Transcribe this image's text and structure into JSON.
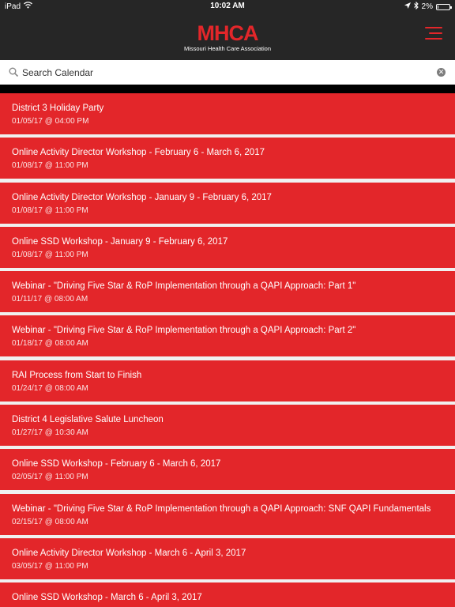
{
  "status_bar": {
    "device": "iPad",
    "time": "10:02 AM",
    "battery": "2%",
    "battery_level": 0.02
  },
  "header": {
    "logo_text": "MHCA",
    "logo_subtitle": "Missouri Health Care Association",
    "accent_color": "#e3262a",
    "background_color": "#262626",
    "menu_icon": "hamburger-menu-icon"
  },
  "search": {
    "placeholder": "Search Calendar",
    "icon": "search-icon",
    "clear_icon": "clear-icon"
  },
  "events": [
    {
      "title": "District 3 Holiday Party",
      "date": "01/05/17 @ 04:00 PM"
    },
    {
      "title": "Online Activity Director Workshop - February 6 - March 6, 2017",
      "date": "01/08/17 @ 11:00 PM"
    },
    {
      "title": "Online Activity Director Workshop - January 9 - February 6, 2017",
      "date": "01/08/17 @ 11:00 PM"
    },
    {
      "title": "Online SSD Workshop - January 9 - February 6, 2017",
      "date": "01/08/17 @ 11:00 PM"
    },
    {
      "title": "Webinar - \"Driving Five Star & RoP Implementation through a QAPI Approach: Part 1\"",
      "date": "01/11/17 @ 08:00 AM"
    },
    {
      "title": "Webinar - \"Driving Five Star & RoP Implementation through a QAPI Approach: Part 2\"",
      "date": "01/18/17 @ 08:00 AM"
    },
    {
      "title": "RAI Process from Start to Finish",
      "date": "01/24/17 @ 08:00 AM"
    },
    {
      "title": "District 4 Legislative Salute Luncheon",
      "date": "01/27/17 @ 10:30 AM"
    },
    {
      "title": "Online SSD Workshop - February 6 - March 6, 2017",
      "date": "02/05/17 @ 11:00 PM"
    },
    {
      "title": "Webinar - \"Driving Five Star & RoP Implementation through a QAPI Approach: SNF QAPI Fundamentals",
      "date": "02/15/17 @ 08:00 AM"
    },
    {
      "title": "Online Activity Director Workshop - March 6 - April 3, 2017",
      "date": "03/05/17 @ 11:00 PM"
    },
    {
      "title": "Online SSD Workshop - March 6 - April 3, 2017",
      "date": ""
    }
  ]
}
